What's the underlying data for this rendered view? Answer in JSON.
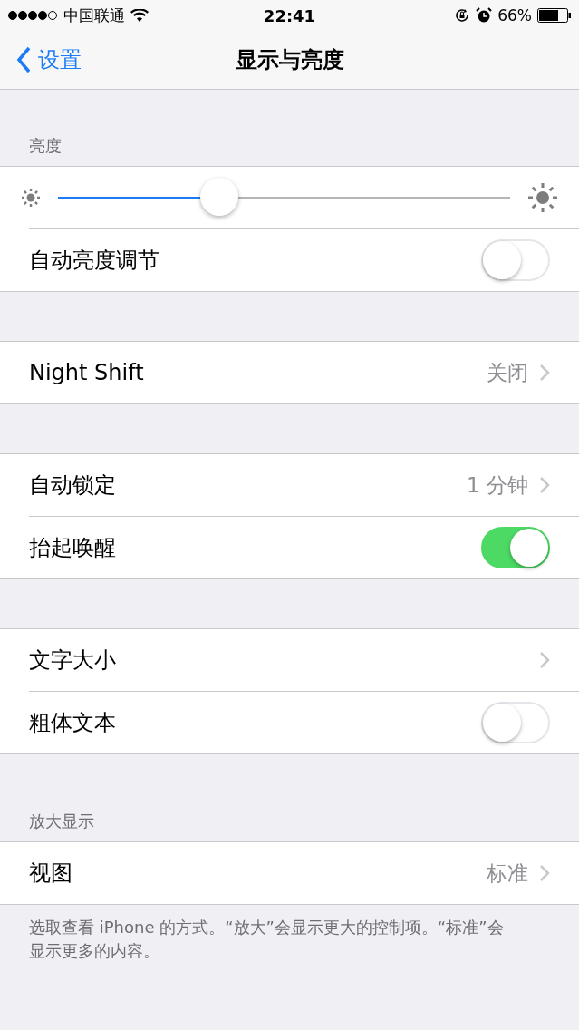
{
  "status_bar": {
    "carrier": "中国联通",
    "time": "22:41",
    "battery": "66%"
  },
  "nav": {
    "back": "设置",
    "title": "显示与亮度"
  },
  "sections": [
    {
      "header": "亮度",
      "rows": [
        {
          "kind": "slider",
          "level": 0.357
        },
        {
          "kind": "toggle",
          "label": "自动亮度调节",
          "on": false
        }
      ]
    },
    {
      "rows": [
        {
          "kind": "link",
          "label": "Night Shift",
          "value": "关闭"
        }
      ]
    },
    {
      "rows": [
        {
          "kind": "link",
          "label": "自动锁定",
          "value": "1 分钟"
        },
        {
          "kind": "toggle",
          "label": "抬起唤醒",
          "on": true
        }
      ]
    },
    {
      "rows": [
        {
          "kind": "link",
          "label": "文字大小"
        },
        {
          "kind": "toggle",
          "label": "粗体文本",
          "on": false
        }
      ]
    },
    {
      "header": "放大显示",
      "rows": [
        {
          "kind": "link",
          "label": "视图",
          "value": "标准"
        }
      ],
      "footer": "选取查看 iPhone 的方式。“放大”会显示更大的控制项。“标准”会显示更多的内容。"
    }
  ]
}
